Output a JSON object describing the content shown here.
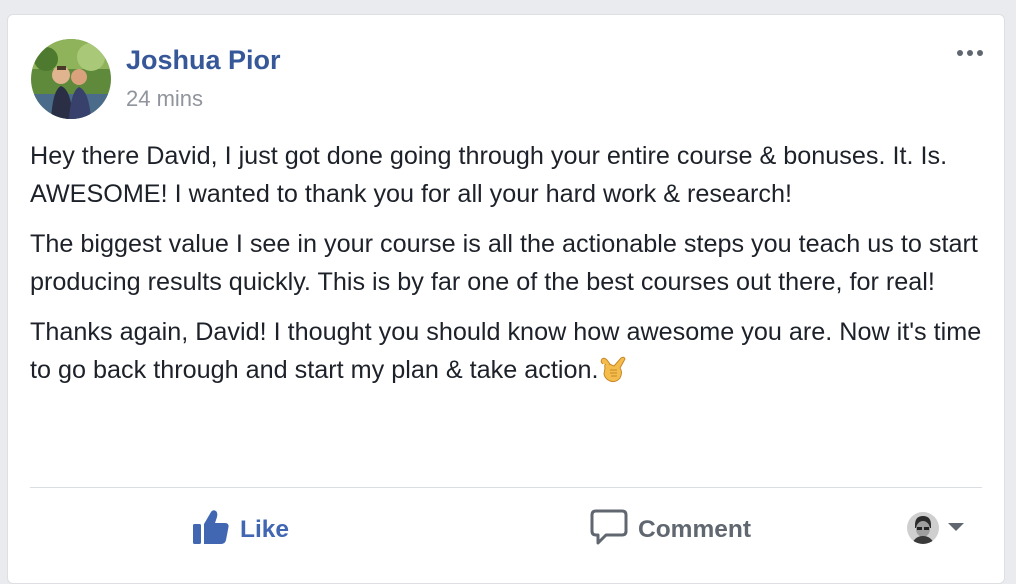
{
  "post": {
    "author_name": "Joshua Pior",
    "timestamp": "24 mins",
    "paragraphs": [
      "Hey there David, I just got done going through your entire course & bonuses. It. Is. AWESOME! I wanted to thank you for all your hard work & research!",
      "The biggest value I see in your course is all the actionable steps you teach us to start producing results quickly. This is by far one of the best courses out there, for real!",
      "Thanks again, David! I thought you should know how awesome you are. Now it's time to go back through and start my plan & take action."
    ],
    "emoji": "call-me-hand-emoji"
  },
  "actions": {
    "like_label": "Like",
    "comment_label": "Comment"
  },
  "icons": {
    "more": "more-options-icon",
    "like": "thumbs-up-icon",
    "comment": "speech-bubble-icon",
    "caret": "caret-down-icon"
  },
  "colors": {
    "author": "#365899",
    "like_blue": "#4267b2",
    "meta_gray": "#90949c",
    "body_text": "#1d2129",
    "action_gray": "#606770",
    "background": "#e9ebee"
  }
}
